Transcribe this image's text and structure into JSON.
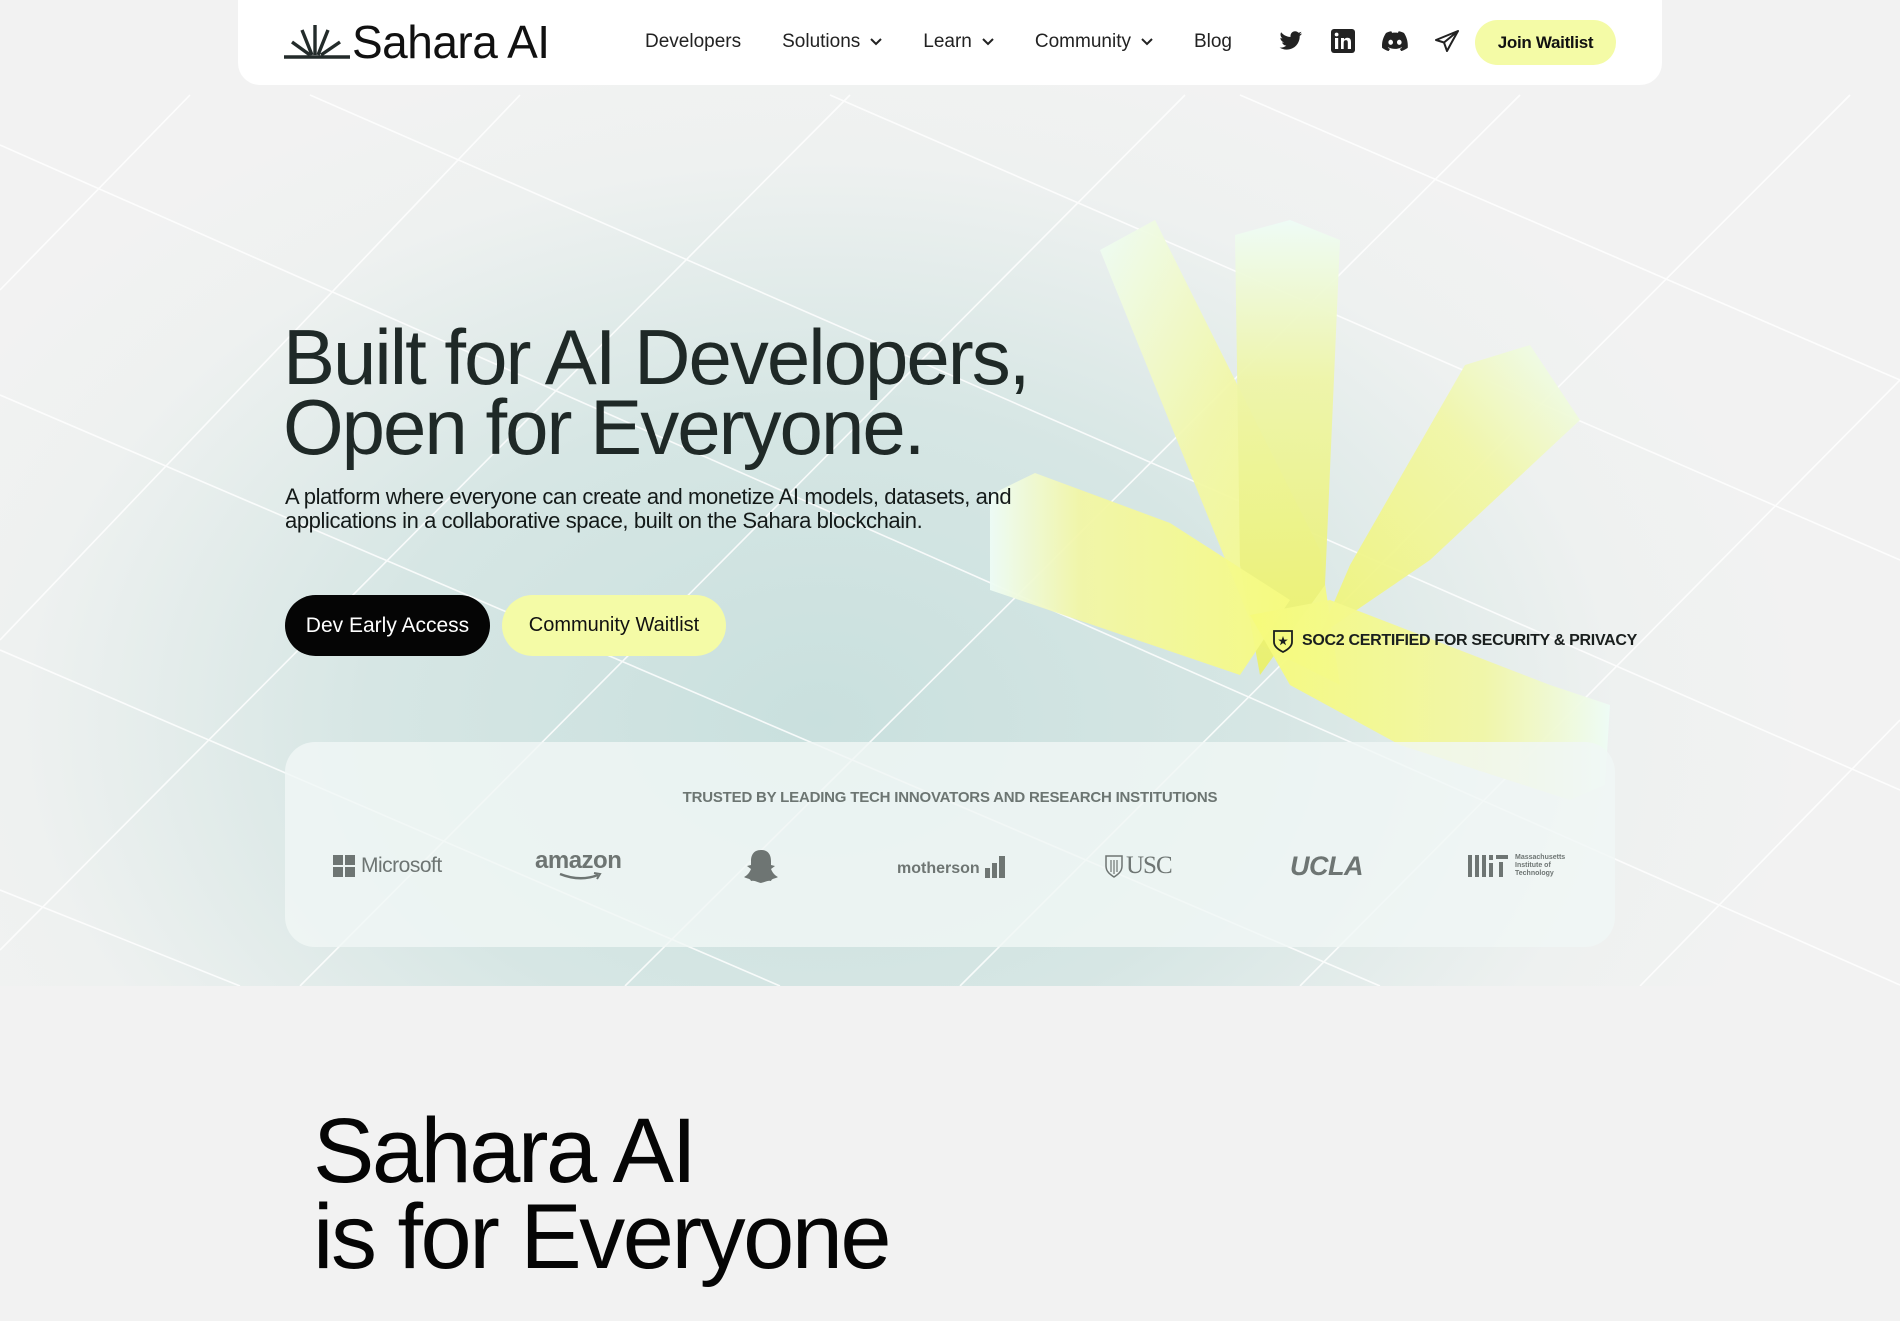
{
  "header": {
    "brand": "Sahara AI",
    "nav": [
      {
        "label": "Developers",
        "dropdown": false
      },
      {
        "label": "Solutions",
        "dropdown": true
      },
      {
        "label": "Learn",
        "dropdown": true
      },
      {
        "label": "Community",
        "dropdown": true
      },
      {
        "label": "Blog",
        "dropdown": false
      }
    ],
    "social_icons": [
      "twitter-icon",
      "linkedin-icon",
      "discord-icon",
      "telegram-icon"
    ],
    "cta_label": "Join Waitlist"
  },
  "hero": {
    "title_line1": "Built for AI Developers,",
    "title_line2": "Open for Everyone.",
    "subtitle_line1": "A platform where everyone can create and monetize AI models, datasets, and",
    "subtitle_line2": "applications in a collaborative space, built on the Sahara blockchain.",
    "primary_button": "Dev Early Access",
    "secondary_button": "Community Waitlist",
    "certification": "SOC2 CERTIFIED FOR SECURITY & PRIVACY"
  },
  "trusted": {
    "title": "TRUSTED BY LEADING TECH INNOVATORS AND RESEARCH INSTITUTIONS",
    "logos": [
      {
        "name": "Microsoft",
        "label": "Microsoft"
      },
      {
        "name": "Amazon",
        "label": "amazon"
      },
      {
        "name": "Snapchat",
        "label": ""
      },
      {
        "name": "Motherson",
        "label": "motherson"
      },
      {
        "name": "USC",
        "label": "USC"
      },
      {
        "name": "UCLA",
        "label": "UCLA"
      },
      {
        "name": "MIT",
        "label": "Massachusetts Institute of Technology",
        "line1": "Massachusetts",
        "line2": "Institute of",
        "line3": "Technology"
      }
    ]
  },
  "section2": {
    "title_line1": "Sahara AI",
    "title_line2": "is for Everyone"
  },
  "colors": {
    "accent_yellow": "#f4fba6",
    "dark_button": "#050505",
    "logo_gray": "#6e7573"
  }
}
